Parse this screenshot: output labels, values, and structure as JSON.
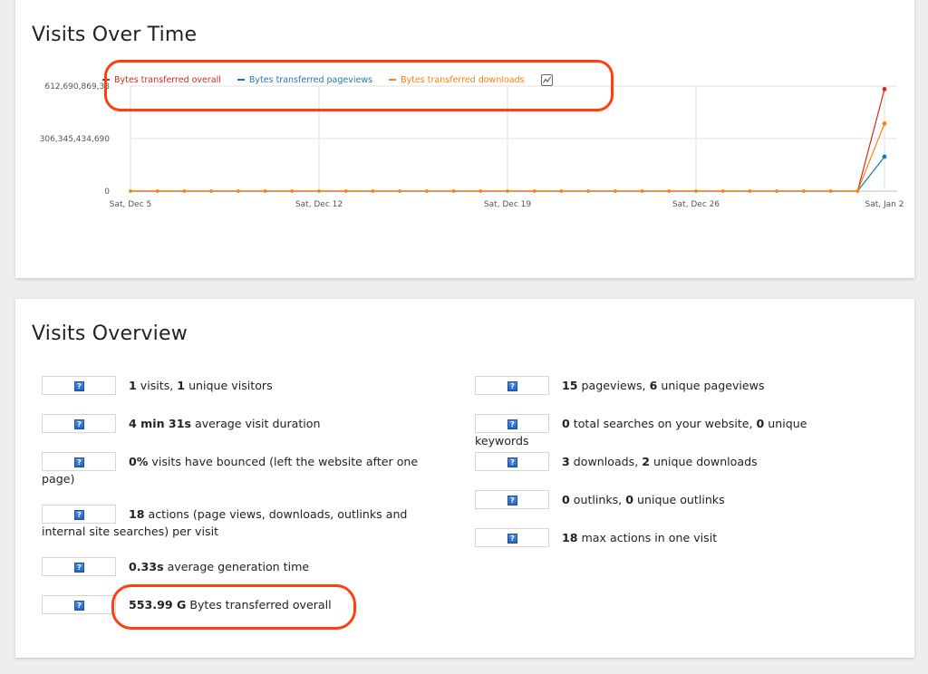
{
  "colors": {
    "overall": "#d4291f",
    "pageviews": "#1f78b4",
    "downloads": "#ff7f0e",
    "highlight": "#ff3f10"
  },
  "visits_over_time": {
    "title": "Visits Over Time",
    "legend": [
      {
        "label": "Bytes transferred overall",
        "color": "#d4291f"
      },
      {
        "label": "Bytes transferred pageviews",
        "color": "#1f78b4"
      },
      {
        "label": "Bytes transferred downloads",
        "color": "#ff7f0e"
      }
    ],
    "legend_icon": "chart-type-icon"
  },
  "chart_data": {
    "type": "line",
    "x": [
      "Sat, Dec 5",
      "Dec 6",
      "Dec 7",
      "Dec 8",
      "Dec 9",
      "Dec 10",
      "Dec 11",
      "Sat, Dec 12",
      "Dec 13",
      "Dec 14",
      "Dec 15",
      "Dec 16",
      "Dec 17",
      "Dec 18",
      "Sat, Dec 19",
      "Dec 20",
      "Dec 21",
      "Dec 22",
      "Dec 23",
      "Dec 24",
      "Dec 25",
      "Sat, Dec 26",
      "Dec 27",
      "Dec 28",
      "Dec 29",
      "Dec 30",
      "Dec 31",
      "Jan 1",
      "Sat, Jan 2"
    ],
    "x_ticks": [
      "Sat, Dec 5",
      "Sat, Dec 12",
      "Sat, Dec 19",
      "Sat, Dec 26",
      "Sat, Jan 2"
    ],
    "y_ticks": [
      "0",
      "306,345,434,690",
      "612,690,869,38"
    ],
    "ylim": [
      0,
      612690869380
    ],
    "series": [
      {
        "name": "Bytes transferred overall",
        "values": [
          0,
          0,
          0,
          0,
          0,
          0,
          0,
          0,
          0,
          0,
          0,
          0,
          0,
          0,
          0,
          0,
          0,
          0,
          0,
          0,
          0,
          0,
          0,
          0,
          0,
          0,
          0,
          0,
          594830000000
        ]
      },
      {
        "name": "Bytes transferred pageviews",
        "values": [
          0,
          0,
          0,
          0,
          0,
          0,
          0,
          0,
          0,
          0,
          0,
          0,
          0,
          0,
          0,
          0,
          0,
          0,
          0,
          0,
          0,
          0,
          0,
          0,
          0,
          0,
          0,
          0,
          201000000000
        ]
      },
      {
        "name": "Bytes transferred downloads",
        "values": [
          0,
          0,
          0,
          0,
          0,
          0,
          0,
          0,
          0,
          0,
          0,
          0,
          0,
          0,
          0,
          0,
          0,
          0,
          0,
          0,
          0,
          0,
          0,
          0,
          0,
          0,
          0,
          0,
          393830000000
        ]
      }
    ],
    "grid": true
  },
  "visits_overview": {
    "title": "Visits Overview",
    "left": [
      {
        "parts": [
          {
            "b": "1"
          },
          {
            "t": " visits, "
          },
          {
            "b": "1"
          },
          {
            "t": " unique visitors"
          }
        ]
      },
      {
        "parts": [
          {
            "b": "4 min 31s"
          },
          {
            "t": " average visit duration"
          }
        ]
      },
      {
        "parts": [
          {
            "b": "0%"
          },
          {
            "t": " visits have bounced (left the website after one page)"
          }
        ]
      },
      {
        "parts": [
          {
            "b": "18"
          },
          {
            "t": " actions (page views, downloads, outlinks and internal site searches) per visit"
          }
        ]
      },
      {
        "parts": [
          {
            "b": "0.33s"
          },
          {
            "t": " average generation time"
          }
        ]
      },
      {
        "parts": [
          {
            "b": "553.99 G"
          },
          {
            "t": " Bytes transferred overall"
          }
        ]
      }
    ],
    "right": [
      {
        "parts": [
          {
            "b": "15"
          },
          {
            "t": " pageviews, "
          },
          {
            "b": "6"
          },
          {
            "t": " unique pageviews"
          }
        ]
      },
      {
        "parts": [
          {
            "b": "0"
          },
          {
            "t": " total searches on your website, "
          },
          {
            "b": "0"
          },
          {
            "t": " unique keywords"
          }
        ]
      },
      {
        "parts": [
          {
            "b": "3"
          },
          {
            "t": " downloads, "
          },
          {
            "b": "2"
          },
          {
            "t": " unique downloads"
          }
        ]
      },
      {
        "parts": [
          {
            "b": "0"
          },
          {
            "t": " outlinks, "
          },
          {
            "b": "0"
          },
          {
            "t": " unique outlinks"
          }
        ]
      },
      {
        "parts": [
          {
            "b": "18"
          },
          {
            "t": " max actions in one visit"
          }
        ]
      }
    ],
    "help_glyph": "?"
  }
}
